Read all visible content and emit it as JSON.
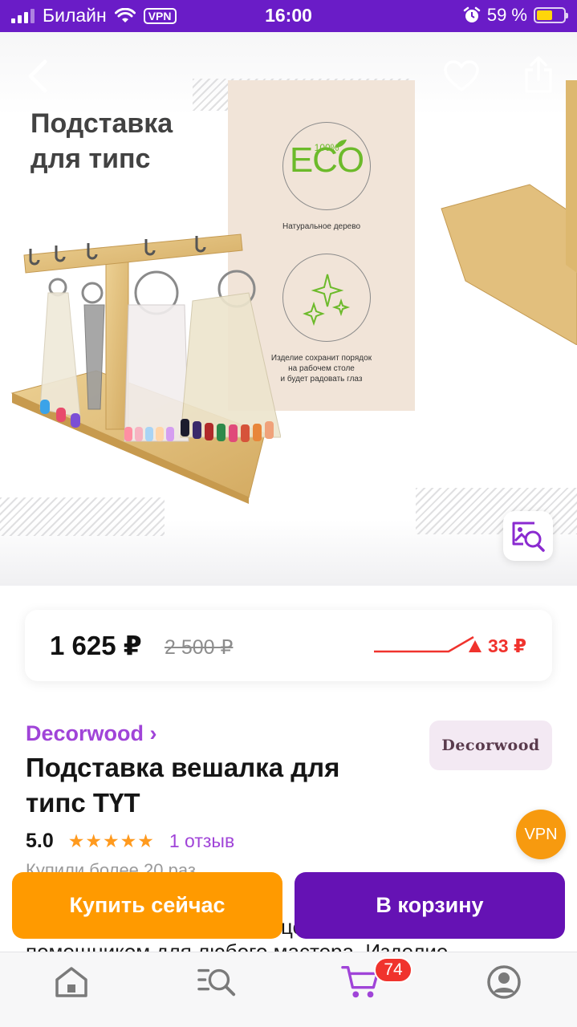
{
  "status_bar": {
    "carrier": "Билайн",
    "vpn": "VPN",
    "time": "16:00",
    "battery": "59 %",
    "battery_level": 0.59
  },
  "gallery": {
    "image_title_line1": "Подставка",
    "image_title_line2": "для типс",
    "eco_label": "ECO",
    "eco_percent": "100%",
    "caption_wood": "Натуральное дерево",
    "caption_order_line1": "Изделие сохранит порядок",
    "caption_order_line2": "на рабочем столе",
    "caption_order_line3": "и будет радовать глаз"
  },
  "price": {
    "current": "1 625 ₽",
    "old": "2 500 ₽",
    "diff": "33 ₽",
    "diff_color": "#f0332d"
  },
  "product": {
    "brand": "Decorwood ›",
    "brand_logo_text": "Decorwood",
    "title": "Подставка вешалка для типс ТҮТ",
    "rating": "5.0",
    "stars": "★★★★★",
    "reviews": "1 отзыв",
    "bought": "Купили более 20 раз",
    "desc_line1": "це",
    "desc_line2": "помощником для любого мастера. Изделие"
  },
  "vpn_fab": "VPN",
  "actions": {
    "buy_now": "Купить сейчас",
    "add_to_cart": "В корзину"
  },
  "tabbar": {
    "cart_count": "74",
    "icons": [
      "home-icon",
      "catalog-search-icon",
      "cart-icon",
      "profile-icon"
    ]
  },
  "colors": {
    "accent": "#6a1cc7",
    "buy": "#ff9a00",
    "cart": "#6512b4",
    "brand_link": "#a044d8"
  }
}
